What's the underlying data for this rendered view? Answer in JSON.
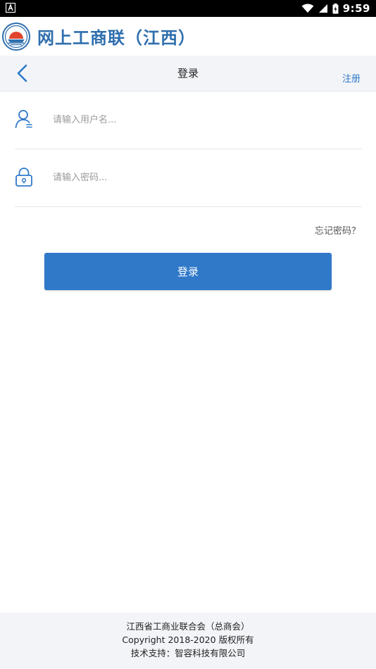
{
  "status_bar": {
    "time": "9:59",
    "left_icon": "notification-a-icon",
    "icons": [
      "wifi-icon",
      "signal-icon",
      "battery-icon"
    ]
  },
  "brand": {
    "title": "网上工商联（江西）",
    "logo_icon": "federation-emblem-icon"
  },
  "nav": {
    "title": "登录",
    "register": "注册",
    "back_icon": "chevron-left-icon"
  },
  "form": {
    "username_placeholder": "请输入用户名...",
    "password_placeholder": "请输入密码...",
    "username_value": "",
    "password_value": "",
    "username_icon": "user-icon",
    "password_icon": "lock-icon",
    "forgot": "忘记密码？",
    "submit": "登录"
  },
  "footer": {
    "line1": "江西省工商业联合会（总商会）",
    "line2": "Copyright 2018-2020 版权所有",
    "line3": "技术支持：智容科技有限公司"
  },
  "colors": {
    "accent": "#3079c9",
    "brand_text": "#2f6fae",
    "nav_bg": "#f2f4f7"
  }
}
